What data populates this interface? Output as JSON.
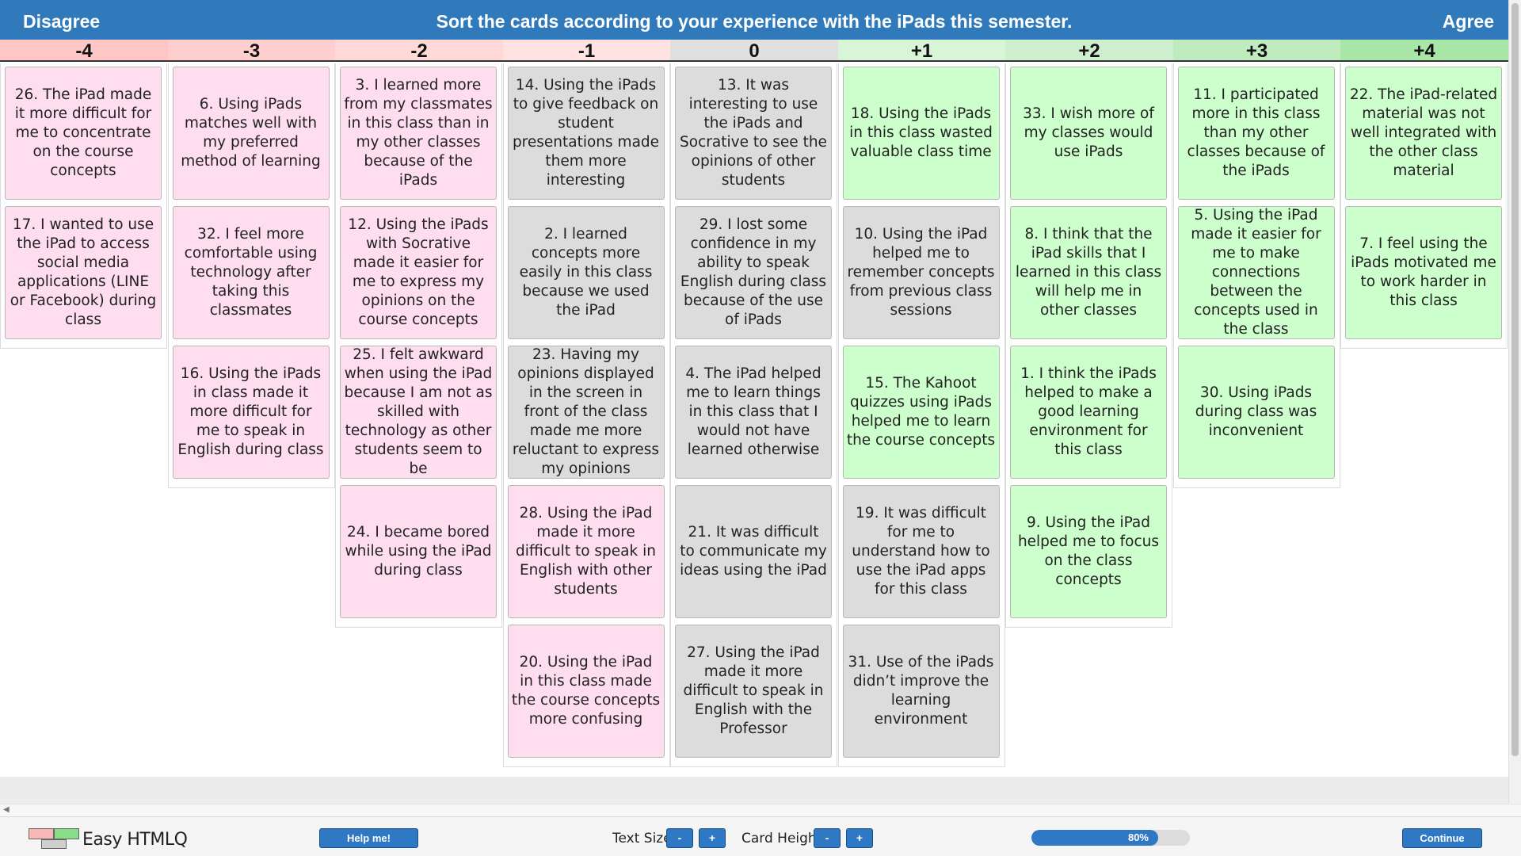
{
  "header": {
    "left_label": "Disagree",
    "instruction": "Sort the cards according to your experience with the iPads this semester.",
    "right_label": "Agree",
    "background": "#3079bb"
  },
  "colors": {
    "negative_card": "#fdddee",
    "neutral_card": "#dcdcdc",
    "positive_card": "#ccffcc"
  },
  "columns": [
    {
      "label": "-4",
      "color": "#ffc6c6",
      "tone": "neg",
      "cards": [
        "26. The iPad made it more difficult for me to concentrate on the course concepts",
        "17. I wanted to use the iPad to access social media applications (LINE or Facebook) during class"
      ]
    },
    {
      "label": "-3",
      "color": "#ffcfcf",
      "tone": "neg",
      "cards": [
        "6. Using iPads matches well with my preferred method of learning",
        "32. I feel more comfortable using technology after taking this classmates",
        "16. Using the iPads in class made it more difficult for me to speak in English during class"
      ]
    },
    {
      "label": "-2",
      "color": "#ffd8d8",
      "tone": "neg",
      "cards": [
        "3. I learned more from my classmates in this class than in my other classes because of the iPads",
        "12. Using the iPads with Socrative made it easier for me to express my opinions on the course concepts",
        "25. I felt awkward when using the iPad because I am not as skilled with technology as other students seem to be",
        "24. I became bored while using the iPad during class"
      ]
    },
    {
      "label": "-1",
      "color": "#ffe3e3",
      "tone": "mixed",
      "cards": [
        "14. Using the iPads to give feedback on student presentations made them more interesting",
        "2. I learned concepts more easily in this class because we used the iPad",
        "23. Having my opinions displayed in the screen in front of the class made me more reluctant to express my opinions",
        "28. Using the iPad made it more difficult to speak in English with other students",
        "20. Using the iPad in this class made the course concepts more confusing"
      ]
    },
    {
      "label": "0",
      "color": "#e0e0e0",
      "tone": "neu",
      "cards": [
        "13. It was interesting to use the iPads and Socrative to see the opinions of other students",
        "29. I lost some confidence in my ability to speak English during class because of the use of iPads",
        "4. The iPad helped me to learn things in this class that I would not have learned otherwise",
        "21. It was difficult to communicate my ideas using the iPad",
        "27. Using the iPad made it more difficult to speak in English with the Professor"
      ]
    },
    {
      "label": "+1",
      "color": "#d8f5d8",
      "tone": "mixed",
      "cards": [
        "18. Using the iPads in this class wasted valuable class time",
        "10. Using the iPad helped me to remember concepts from previous class sessions",
        "15. The Kahoot quizzes using iPads helped me to learn the course concepts",
        "19. It was difficult for me to understand how to use the iPad apps for this class",
        "31. Use of the iPads didn’t improve the learning environment"
      ]
    },
    {
      "label": "+2",
      "color": "#cdefcd",
      "tone": "pos",
      "cards": [
        "33. I wish more of my classes would use iPads",
        "8. I think that the iPad skills that I learned in this class will help me in other classes",
        "1. I think the iPads helped to make a good learning environment for this class",
        "9. Using the iPad helped me to focus on the class concepts"
      ]
    },
    {
      "label": "+3",
      "color": "#bfebbf",
      "tone": "pos",
      "cards": [
        "11. I participated more in this class than my other classes because of the iPads",
        "5. Using the iPad made it easier for me to make connections between the concepts used in the class",
        "30. Using iPads during class was inconvenient"
      ]
    },
    {
      "label": "+4",
      "color": "#a9e7a9",
      "tone": "pos",
      "cards": [
        "22. The iPad-related material was not well integrated with the other class material",
        "7. I feel using the iPads motivated me to work harder in this class"
      ]
    }
  ],
  "card_tones": {
    "3": [
      "neu",
      "neu",
      "neu",
      "neg",
      "neg"
    ],
    "5": [
      "pos",
      "neu",
      "pos",
      "neu",
      "neu"
    ]
  },
  "footer": {
    "app_name": "Easy HTMLQ",
    "help_label": "Help me!",
    "text_size_label": "Text Size",
    "card_height_label": "Card Height",
    "minus_label": "-",
    "plus_label": "+",
    "progress_percent": 80,
    "progress_label": "80%",
    "continue_label": "Continue"
  }
}
